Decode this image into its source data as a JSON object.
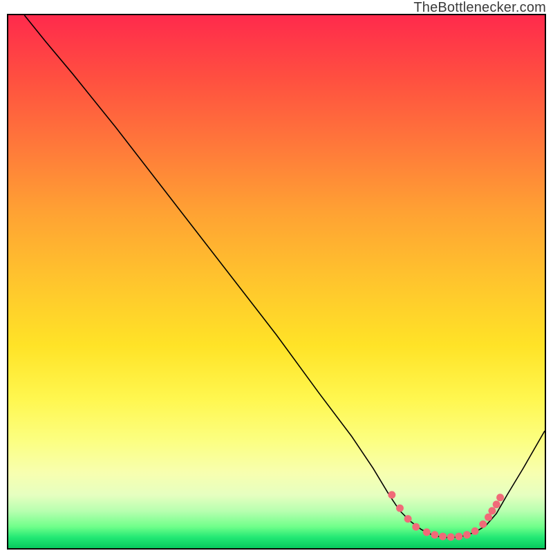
{
  "watermark": {
    "text": "TheBottlenecker.com"
  },
  "chart_data": {
    "type": "line",
    "title": "",
    "xlabel": "",
    "ylabel": "",
    "xlim": [
      0,
      100
    ],
    "ylim": [
      0,
      100
    ],
    "grid": false,
    "legend": false,
    "background_gradient": [
      {
        "stop": 0,
        "color": "#ff2a4c"
      },
      {
        "stop": 50,
        "color": "#ffc52d"
      },
      {
        "stop": 80,
        "color": "#fcff82"
      },
      {
        "stop": 100,
        "color": "#07c85e"
      }
    ],
    "series": [
      {
        "name": "bottleneck-curve",
        "color": "#000000",
        "x": [
          3,
          7,
          12,
          20,
          30,
          40,
          50,
          58,
          64,
          68,
          71,
          73,
          75,
          77,
          79,
          81,
          83,
          85,
          87,
          89,
          91,
          93,
          96,
          100
        ],
        "y": [
          100,
          95,
          89,
          79,
          66,
          53,
          40,
          29,
          21,
          15,
          10,
          7,
          5,
          3.5,
          2.5,
          2,
          2,
          2.3,
          3,
          4.2,
          6.5,
          10,
          15,
          22
        ]
      },
      {
        "name": "tolerance-markers",
        "type": "scatter",
        "color": "#f06a78",
        "x": [
          71.5,
          73,
          74.5,
          76,
          78,
          79.5,
          81,
          82.5,
          84,
          85.5,
          87,
          88.5,
          89.5,
          90.2,
          91,
          91.7
        ],
        "y": [
          10,
          7.5,
          5.5,
          4,
          3,
          2.5,
          2.2,
          2.1,
          2.2,
          2.5,
          3.2,
          4.5,
          5.8,
          7,
          8.2,
          9.5
        ]
      }
    ]
  }
}
